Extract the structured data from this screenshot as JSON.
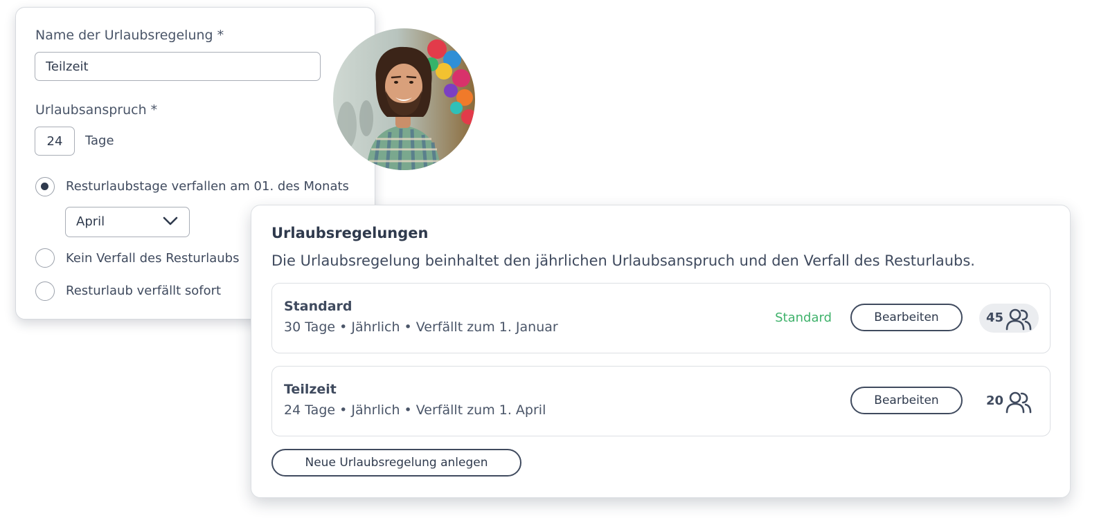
{
  "form": {
    "name_label": "Name der Urlaubsregelung *",
    "name_value": "Teilzeit",
    "entitlement_label": "Urlaubsanspruch *",
    "entitlement_value": "24",
    "entitlement_unit": "Tage",
    "options": [
      {
        "label": "Resturlaubstage verfallen am 01. des Monats",
        "selected": true
      },
      {
        "label": "Kein Verfall des Resturlaubs",
        "selected": false
      },
      {
        "label": "Resturlaub verfällt sofort",
        "selected": false
      }
    ],
    "month_select": {
      "value": "April"
    }
  },
  "avatar": {
    "icon": "user-photo"
  },
  "policies": {
    "title": "Urlaubsregelungen",
    "description": "Die Urlaubsregelung beinhaltet den jährlichen Urlaubsanspruch und den Verfall des Resturlaubs.",
    "items": [
      {
        "name": "Standard",
        "details": "30 Tage • Jährlich • Verfällt zum 1. Januar",
        "badge": "Standard",
        "edit_label": "Bearbeiten",
        "member_count": "45"
      },
      {
        "name": "Teilzeit",
        "details": "24 Tage • Jährlich • Verfällt zum 1. April",
        "edit_label": "Bearbeiten",
        "member_count": "20"
      }
    ],
    "new_button_label": "Neue Urlaubsregelung anlegen"
  },
  "colors": {
    "text": "#3f4a5e",
    "badge_green": "#3fb26b",
    "border": "#a8adb6",
    "pill_bg": "#ebedf0"
  }
}
